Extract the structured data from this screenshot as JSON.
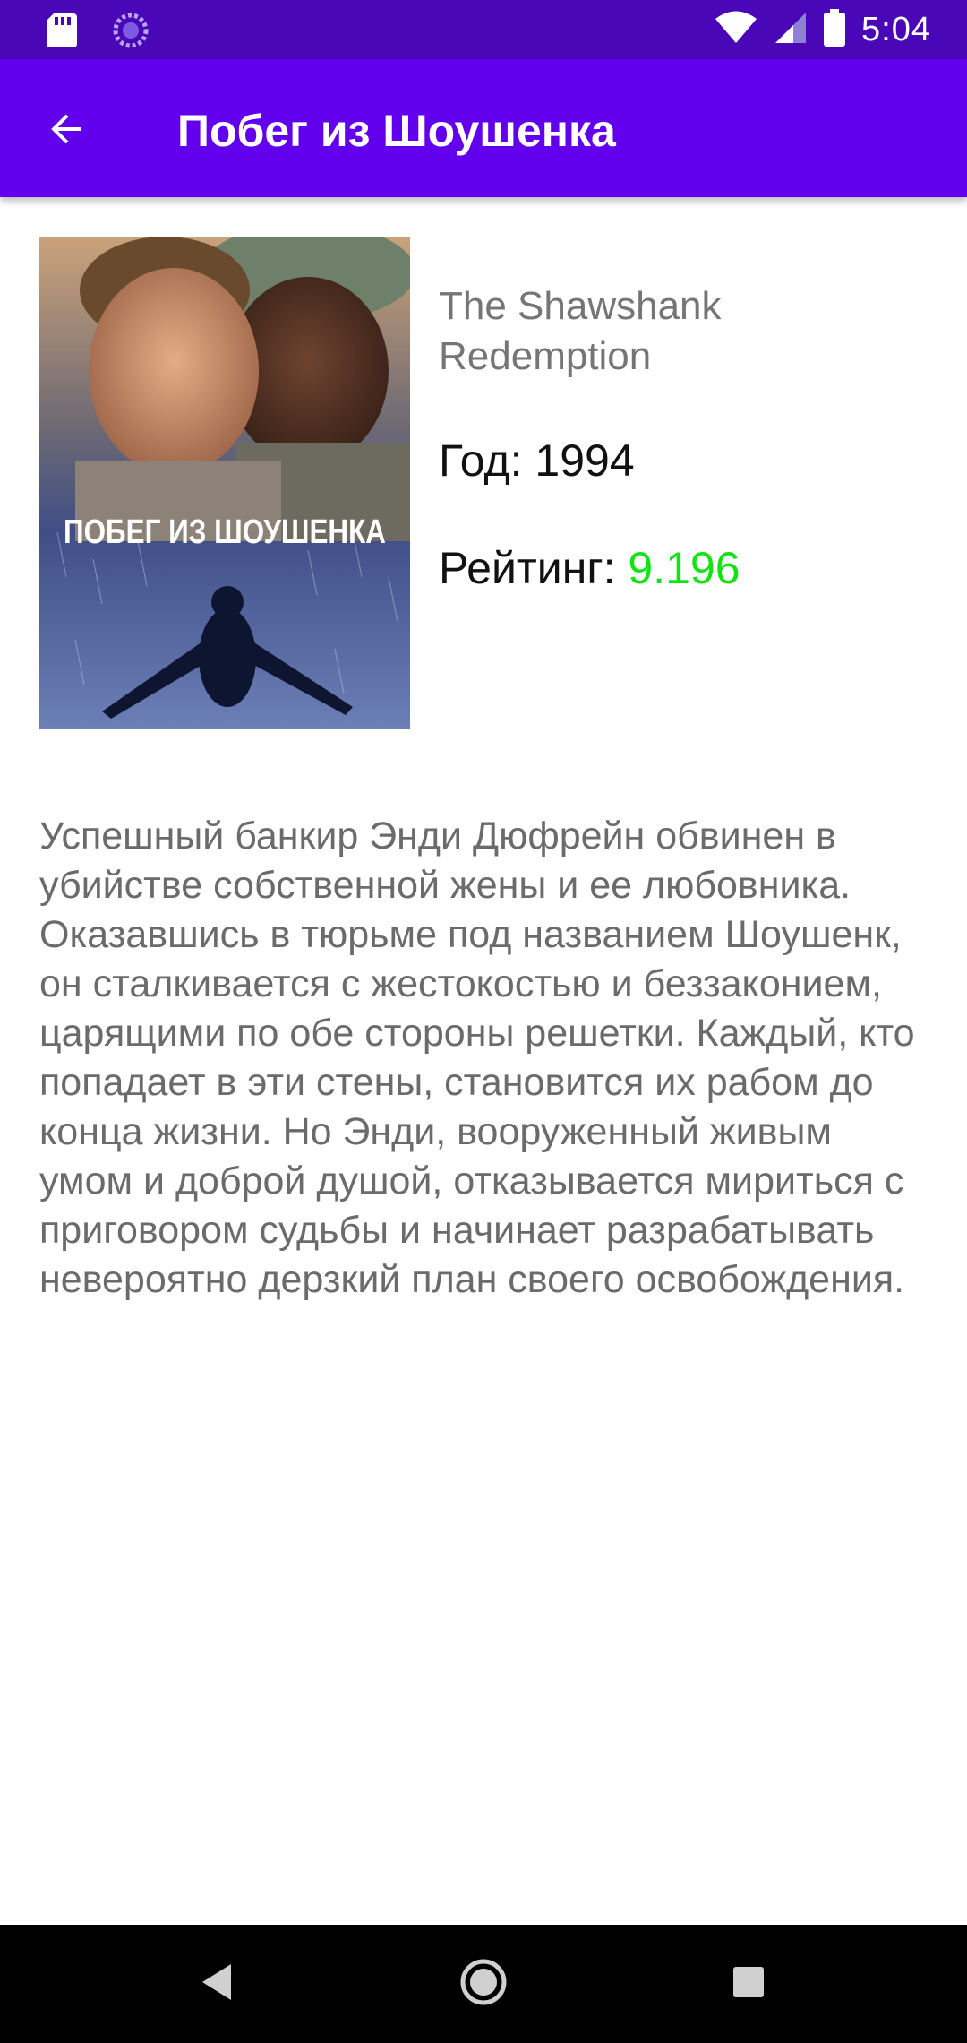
{
  "status_bar": {
    "time": "5:04",
    "icons": [
      "sd-card-icon",
      "sync-icon",
      "wifi-icon",
      "signal-icon",
      "battery-icon"
    ]
  },
  "app_bar": {
    "title": "Побег из Шоушенка",
    "back_icon": "arrow-back-icon",
    "background": "#6200ee"
  },
  "movie": {
    "poster_text": "ПОБЕГ ИЗ ШОУШЕНКА",
    "original_title": "The Shawshank Redemption",
    "year_label": "Год:",
    "year": "1994",
    "rating_label": "Рейтинг:",
    "rating": "9.196",
    "rating_color": "#13e313",
    "description": "Успешный банкир Энди Дюфрейн обвинен в убийстве собственной жены и ее любовника. Оказавшись в тюрьме под названием Шоушенк, он сталкивается с жестокостью и беззаконием, царящими по обе стороны решетки. Каждый, кто попадает в эти стены, становится их рабом до конца жизни. Но Энди, вооруженный живым умом и доброй душой, отказывается мириться с приговором судьбы и начинает разрабатывать невероятно дерзкий план своего освобождения."
  },
  "nav_bar": {
    "buttons": [
      "back-nav-icon",
      "home-nav-icon",
      "recents-nav-icon"
    ]
  }
}
